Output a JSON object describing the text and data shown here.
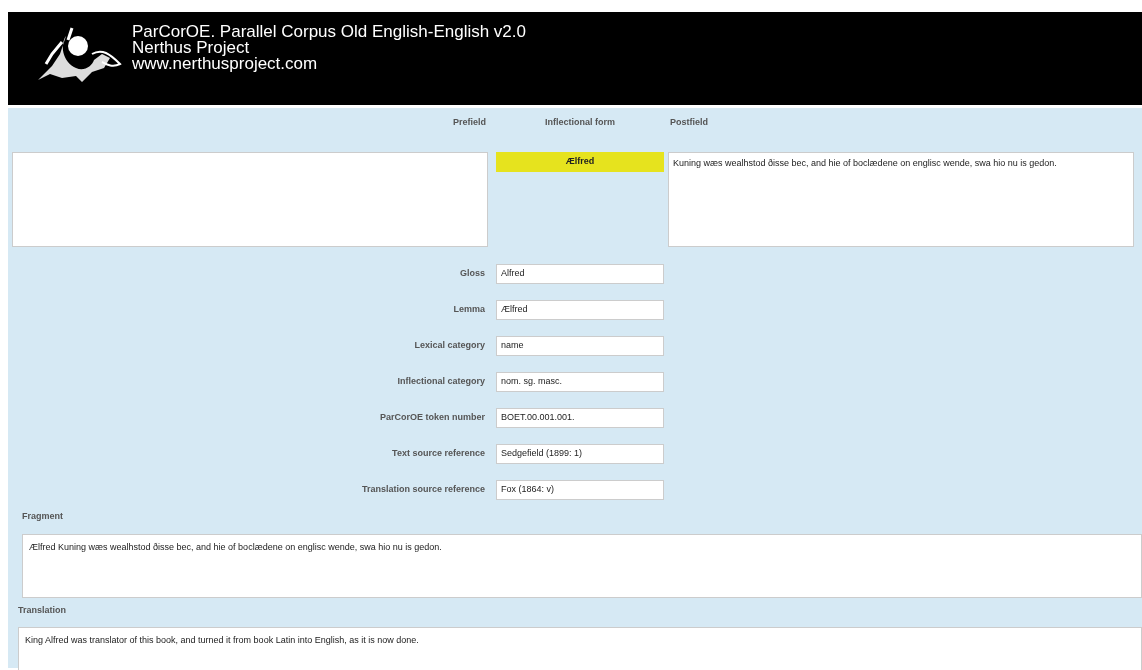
{
  "header": {
    "title": "ParCorOE. Parallel Corpus Old English-English v2.0",
    "subtitle": "Nerthus Project",
    "url": "www.nerthusproject.com"
  },
  "columns": [
    "Prefield",
    "Inflectional form",
    "Postfield"
  ],
  "inflectional_form": {
    "value": "Ælfred"
  },
  "postfield": {
    "value": "Kuning wæs wealhstod ðisse bec, and hie of boclædene on englisc wende, swa hio nu is gedon."
  },
  "fields": [
    {
      "label": "Gloss",
      "value": "Alfred"
    },
    {
      "label": "Lemma",
      "value": "Ælfred"
    },
    {
      "label": "Lexical category",
      "value": "name"
    },
    {
      "label": "Inflectional category",
      "value": "nom. sg. masc."
    },
    {
      "label": "ParCorOE token number",
      "value": "BOET.00.001.001."
    },
    {
      "label": "Text source reference",
      "value": "Sedgefield (1899: 1)"
    },
    {
      "label": "Translation source reference",
      "value": "Fox (1864: v)"
    }
  ],
  "fragment": {
    "label": "Fragment",
    "value": "Ælfred Kuning wæs wealhstod ðisse bec, and hie of boclædene on englisc wende, swa hio nu is gedon."
  },
  "translation": {
    "label": "Translation",
    "value": "King Alfred was translator of this book, and turned it from book Latin into English, as it is now done."
  }
}
